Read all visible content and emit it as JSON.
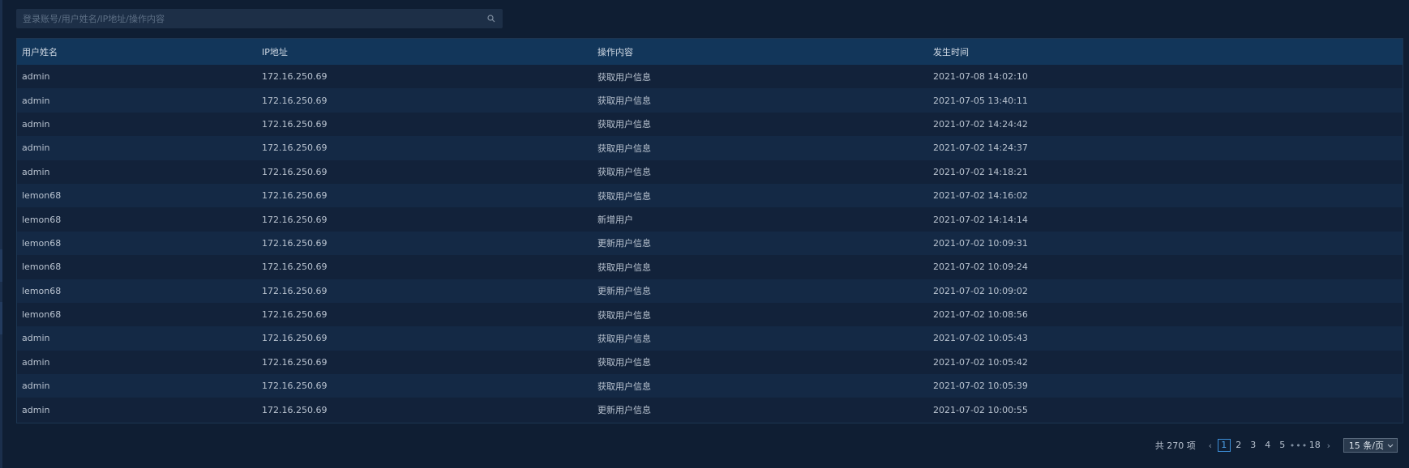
{
  "search": {
    "placeholder": "登录账号/用户姓名/IP地址/操作内容",
    "value": ""
  },
  "table": {
    "columns": [
      "用户姓名",
      "IP地址",
      "操作内容",
      "发生时间"
    ],
    "rows": [
      [
        "admin",
        "172.16.250.69",
        "获取用户信息",
        "2021-07-08 14:02:10"
      ],
      [
        "admin",
        "172.16.250.69",
        "获取用户信息",
        "2021-07-05 13:40:11"
      ],
      [
        "admin",
        "172.16.250.69",
        "获取用户信息",
        "2021-07-02 14:24:42"
      ],
      [
        "admin",
        "172.16.250.69",
        "获取用户信息",
        "2021-07-02 14:24:37"
      ],
      [
        "admin",
        "172.16.250.69",
        "获取用户信息",
        "2021-07-02 14:18:21"
      ],
      [
        "lemon68",
        "172.16.250.69",
        "获取用户信息",
        "2021-07-02 14:16:02"
      ],
      [
        "lemon68",
        "172.16.250.69",
        "新增用户",
        "2021-07-02 14:14:14"
      ],
      [
        "lemon68",
        "172.16.250.69",
        "更新用户信息",
        "2021-07-02 10:09:31"
      ],
      [
        "lemon68",
        "172.16.250.69",
        "获取用户信息",
        "2021-07-02 10:09:24"
      ],
      [
        "lemon68",
        "172.16.250.69",
        "更新用户信息",
        "2021-07-02 10:09:02"
      ],
      [
        "lemon68",
        "172.16.250.69",
        "获取用户信息",
        "2021-07-02 10:08:56"
      ],
      [
        "admin",
        "172.16.250.69",
        "获取用户信息",
        "2021-07-02 10:05:43"
      ],
      [
        "admin",
        "172.16.250.69",
        "获取用户信息",
        "2021-07-02 10:05:42"
      ],
      [
        "admin",
        "172.16.250.69",
        "获取用户信息",
        "2021-07-02 10:05:39"
      ],
      [
        "admin",
        "172.16.250.69",
        "更新用户信息",
        "2021-07-02 10:00:55"
      ]
    ]
  },
  "pagination": {
    "total_label": "共 270 项",
    "prev_icon": "chevron-left-icon",
    "next_icon": "chevron-right-icon",
    "pages": [
      "1",
      "2",
      "3",
      "4",
      "5"
    ],
    "ellipsis": "•••",
    "last_page": "18",
    "current": "1",
    "page_size_label": "15 条/页"
  },
  "colors": {
    "background": "#0f1e33",
    "header_row": "#12365a",
    "accent": "#3d8fd9"
  }
}
